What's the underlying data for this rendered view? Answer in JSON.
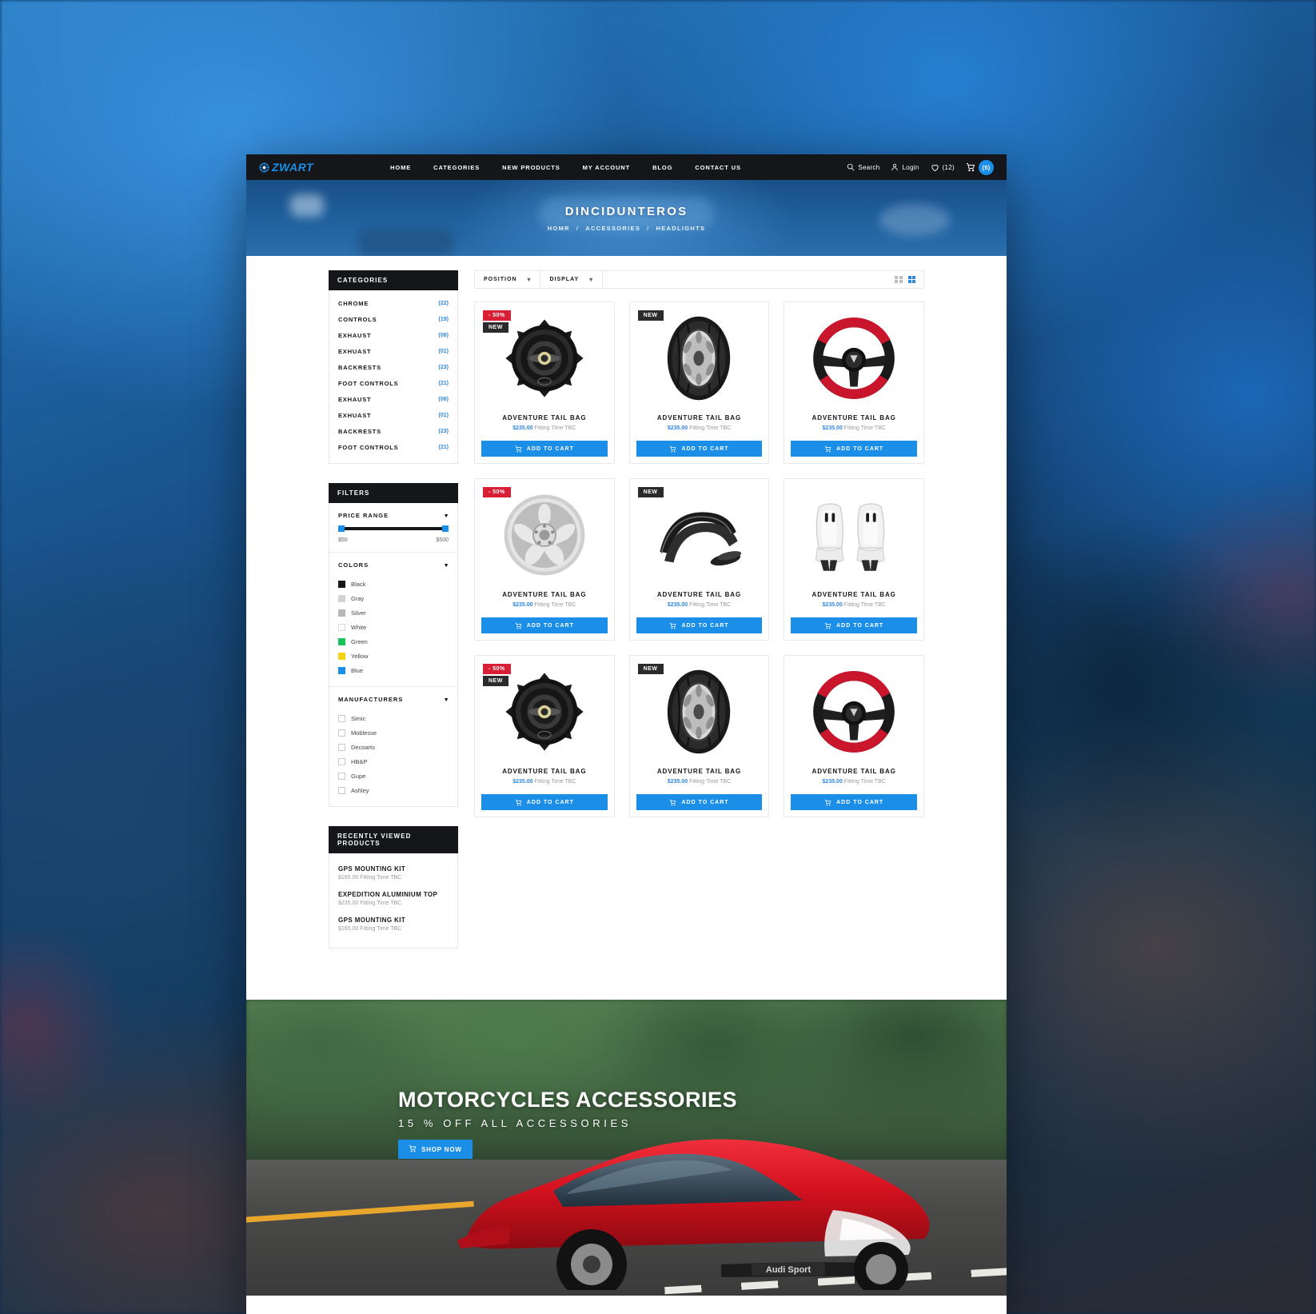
{
  "header": {
    "logo_text": "ZWART",
    "menu": [
      {
        "label": "HOME"
      },
      {
        "label": "CATEGORIES"
      },
      {
        "label": "NEW PRODUCTS"
      },
      {
        "label": "MY ACCOUNT"
      },
      {
        "label": "BLOG"
      },
      {
        "label": "CONTACT US"
      }
    ],
    "search_label": "Search",
    "login_label": "Login",
    "wishlist_count": "(12)",
    "cart_count": "(5)"
  },
  "hero": {
    "title": "DINCIDUNTEROS",
    "breadcrumb": [
      "HOMR",
      "/",
      "ACCESSORIES",
      "/",
      "HEADLIGHTS"
    ]
  },
  "sidebar": {
    "categories_title": "CATEGORIES",
    "categories": [
      {
        "name": "CHROME",
        "count": "(22)"
      },
      {
        "name": "CONTROLS",
        "count": "(19)"
      },
      {
        "name": "EXHAUST",
        "count": "(06)"
      },
      {
        "name": "EXHUAST",
        "count": "(01)"
      },
      {
        "name": "BACKRESTS",
        "count": "(23)"
      },
      {
        "name": "FOOT CONTROLS",
        "count": "(21)"
      },
      {
        "name": "EXHAUST",
        "count": "(06)"
      },
      {
        "name": "EXHUAST",
        "count": "(01)"
      },
      {
        "name": "BACKRESTS",
        "count": "(23)"
      },
      {
        "name": "FOOT CONTROLS",
        "count": "(21)"
      }
    ],
    "filters_title": "FILTERS",
    "price": {
      "label": "PRICE RANGE",
      "min": "$50",
      "max": "$500"
    },
    "colors": {
      "label": "COLORS",
      "items": [
        {
          "label": "Black",
          "hex": "#15161a"
        },
        {
          "label": "Gray",
          "hex": "#d2d2d2"
        },
        {
          "label": "Silver",
          "hex": "#b8b8b8"
        },
        {
          "label": "White",
          "hex": "#ffffff"
        },
        {
          "label": "Green",
          "hex": "#18c457"
        },
        {
          "label": "Yellow",
          "hex": "#f5d310"
        },
        {
          "label": "Blue",
          "hex": "#1b8ee8"
        }
      ]
    },
    "manufacturers": {
      "label": "MANUFACTURERS",
      "items": [
        {
          "label": "Simic"
        },
        {
          "label": "Moblesse"
        },
        {
          "label": "Decoarts"
        },
        {
          "label": "HB&P"
        },
        {
          "label": "Gupe"
        },
        {
          "label": "Ashley"
        }
      ]
    },
    "recently_viewed": {
      "title": "RECENTLY VIEWED PRODUCTS",
      "items": [
        {
          "name": "GPS MOUNTING KIT",
          "meta": "$165.00 Fitting Time TBC"
        },
        {
          "name": "EXPEDITION ALUMINIUM TOP",
          "meta": "$235.00 Fitting Time TBC"
        },
        {
          "name": "GPS MOUNTING KIT",
          "meta": "$165.00 Fitting Time TBC"
        }
      ]
    }
  },
  "toolbar": {
    "position_label": "POSITION",
    "display_label": "DISPLAY"
  },
  "products": [
    {
      "name": "ADVENTURE TAIL BAG",
      "price": "$235.00",
      "meta": "Fitting Time TBC",
      "sale_badge": "- 50%",
      "new_badge": "NEW",
      "cta": "ADD TO CART",
      "image": "speaker"
    },
    {
      "name": "ADVENTURE TAIL BAG",
      "price": "$235.00",
      "meta": "Fitting Time TBC",
      "sale_badge": "",
      "new_badge": "NEW",
      "cta": "ADD TO CART",
      "image": "tyre"
    },
    {
      "name": "ADVENTURE TAIL BAG",
      "price": "$235.00",
      "meta": "Fitting Time TBC",
      "sale_badge": "",
      "new_badge": "",
      "cta": "ADD TO CART",
      "image": "wheel-red"
    },
    {
      "name": "ADVENTURE TAIL BAG",
      "price": "$235.00",
      "meta": "Fitting Time TBC",
      "sale_badge": "- 50%",
      "new_badge": "",
      "cta": "ADD TO CART",
      "image": "rim"
    },
    {
      "name": "ADVENTURE TAIL BAG",
      "price": "$235.00",
      "meta": "Fitting Time TBC",
      "sale_badge": "",
      "new_badge": "NEW",
      "cta": "ADD TO CART",
      "image": "fender"
    },
    {
      "name": "ADVENTURE TAIL BAG",
      "price": "$235.00",
      "meta": "Fitting Time TBC",
      "sale_badge": "",
      "new_badge": "",
      "cta": "ADD TO CART",
      "image": "seats"
    },
    {
      "name": "ADVENTURE TAIL BAG",
      "price": "$235.00",
      "meta": "Fitting Time TBC",
      "sale_badge": "- 50%",
      "new_badge": "NEW",
      "cta": "ADD TO CART",
      "image": "speaker"
    },
    {
      "name": "ADVENTURE TAIL BAG",
      "price": "$235.00",
      "meta": "Fitting Time TBC",
      "sale_badge": "",
      "new_badge": "NEW",
      "cta": "ADD TO CART",
      "image": "tyre"
    },
    {
      "name": "ADVENTURE TAIL BAG",
      "price": "$235.00",
      "meta": "Fitting Time TBC",
      "sale_badge": "",
      "new_badge": "",
      "cta": "ADD TO CART",
      "image": "wheel-red"
    }
  ],
  "banner": {
    "title": "MOTORCYCLES ACCESSORIES",
    "subtitle": "15 % OFF ALL ACCESSORIES",
    "cta": "SHOP NOW",
    "car_badge": "Audi Sport"
  },
  "colors": {
    "accent": "#1b8ee8",
    "dark": "#15161a",
    "sale": "#d81f36"
  }
}
